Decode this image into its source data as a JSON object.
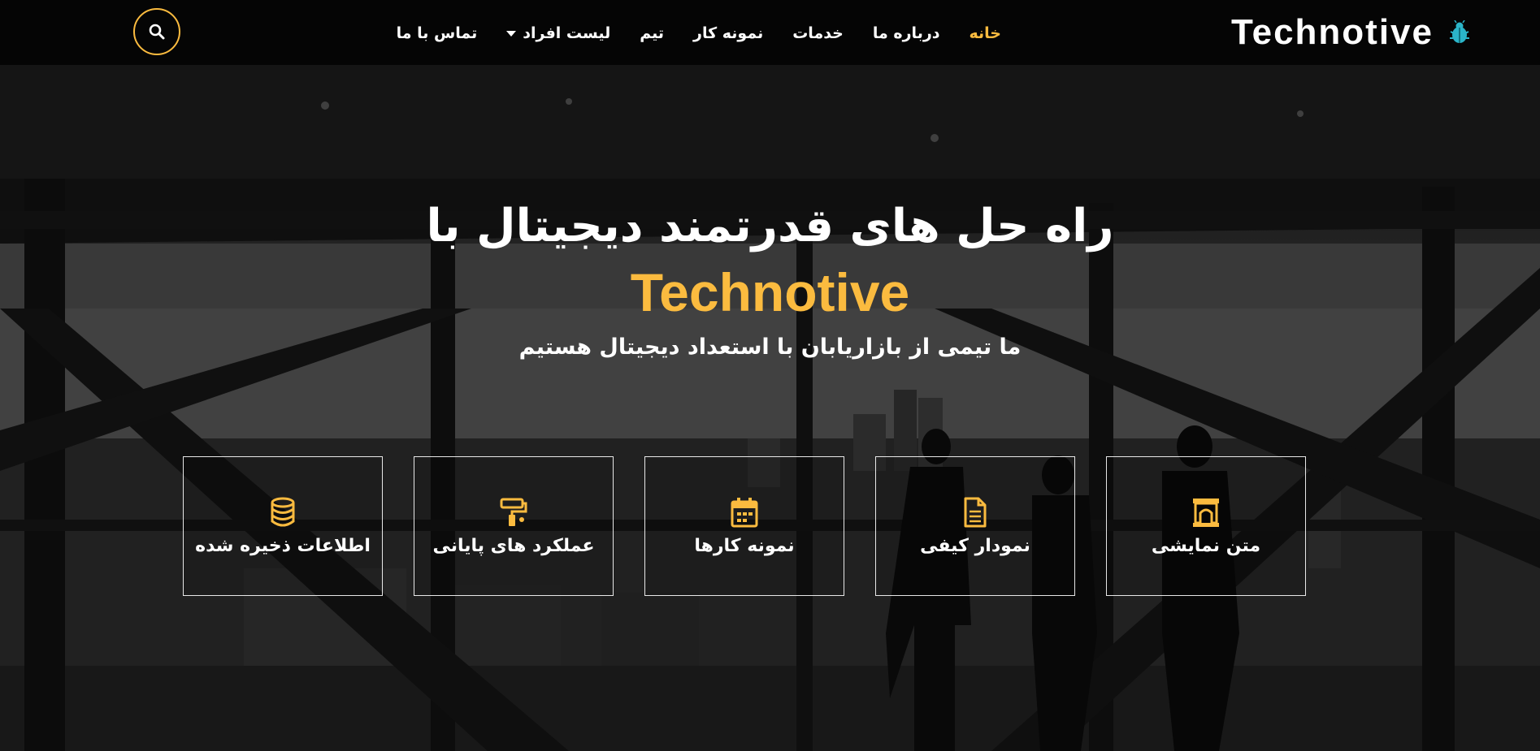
{
  "brand": {
    "name": "Technotive",
    "accent_color": "#fbbb3f",
    "logo_icon": "bug-icon"
  },
  "nav": {
    "items": [
      {
        "label": "خانه",
        "active": true
      },
      {
        "label": "درباره ما",
        "active": false
      },
      {
        "label": "خدمات",
        "active": false
      },
      {
        "label": "نمونه کار",
        "active": false
      },
      {
        "label": "تیم",
        "active": false
      },
      {
        "label": "لیست افراد",
        "active": false,
        "dropdown": true
      },
      {
        "label": "تماس با ما",
        "active": false
      }
    ],
    "search_icon": "search-icon"
  },
  "hero": {
    "title": "راه حل های قدرتمند دیجیتال با",
    "brand": "Technotive",
    "subtitle": "ما تیمی از بازاریابان با استعداد دیجیتال هستیم"
  },
  "features": [
    {
      "label": "متن نمایشی",
      "icon": "archway-icon"
    },
    {
      "label": "نمودار کیفی",
      "icon": "file-alt-icon"
    },
    {
      "label": "نمونه کارها",
      "icon": "calendar-icon"
    },
    {
      "label": "عملکرد های پایانی",
      "icon": "paint-roller-icon"
    },
    {
      "label": "اطلاعات ذخیره شده",
      "icon": "database-icon"
    }
  ]
}
